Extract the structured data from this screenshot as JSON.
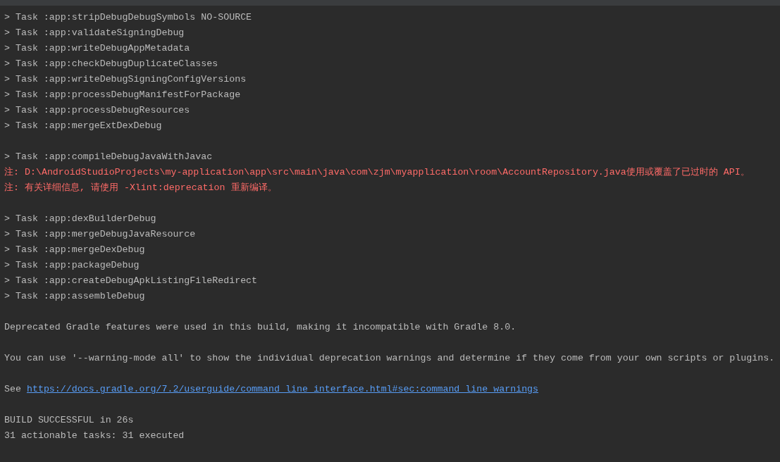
{
  "console": {
    "lines": [
      {
        "kind": "task",
        "text": "> Task :app:stripDebugDebugSymbols NO-SOURCE"
      },
      {
        "kind": "task",
        "text": "> Task :app:validateSigningDebug"
      },
      {
        "kind": "task",
        "text": "> Task :app:writeDebugAppMetadata"
      },
      {
        "kind": "task",
        "text": "> Task :app:checkDebugDuplicateClasses"
      },
      {
        "kind": "task",
        "text": "> Task :app:writeDebugSigningConfigVersions"
      },
      {
        "kind": "task",
        "text": "> Task :app:processDebugManifestForPackage"
      },
      {
        "kind": "task",
        "text": "> Task :app:processDebugResources"
      },
      {
        "kind": "task",
        "text": "> Task :app:mergeExtDexDebug"
      },
      {
        "kind": "blank"
      },
      {
        "kind": "task",
        "text": "> Task :app:compileDebugJavaWithJavac"
      },
      {
        "kind": "error",
        "text": "注: D:\\AndroidStudioProjects\\my-application\\app\\src\\main\\java\\com\\zjm\\myapplication\\room\\AccountRepository.java使用或覆盖了已过时的 API。"
      },
      {
        "kind": "error",
        "text": "注: 有关详细信息, 请使用 -Xlint:deprecation 重新编译。"
      },
      {
        "kind": "blank"
      },
      {
        "kind": "task",
        "text": "> Task :app:dexBuilderDebug"
      },
      {
        "kind": "task",
        "text": "> Task :app:mergeDebugJavaResource"
      },
      {
        "kind": "task",
        "text": "> Task :app:mergeDexDebug"
      },
      {
        "kind": "task",
        "text": "> Task :app:packageDebug"
      },
      {
        "kind": "task",
        "text": "> Task :app:createDebugApkListingFileRedirect"
      },
      {
        "kind": "task",
        "text": "> Task :app:assembleDebug"
      },
      {
        "kind": "blank"
      },
      {
        "kind": "plain",
        "text": "Deprecated Gradle features were used in this build, making it incompatible with Gradle 8.0."
      },
      {
        "kind": "blank"
      },
      {
        "kind": "plain",
        "text": "You can use '--warning-mode all' to show the individual deprecation warnings and determine if they come from your own scripts or plugins."
      },
      {
        "kind": "blank"
      },
      {
        "kind": "link",
        "text": "See",
        "url": "https://docs.gradle.org/7.2/userguide/command_line_interface.html#sec:command_line_warnings"
      },
      {
        "kind": "blank"
      },
      {
        "kind": "plain",
        "text": "BUILD SUCCESSFUL in 26s"
      },
      {
        "kind": "plain",
        "text": "31 actionable tasks: 31 executed"
      }
    ]
  }
}
